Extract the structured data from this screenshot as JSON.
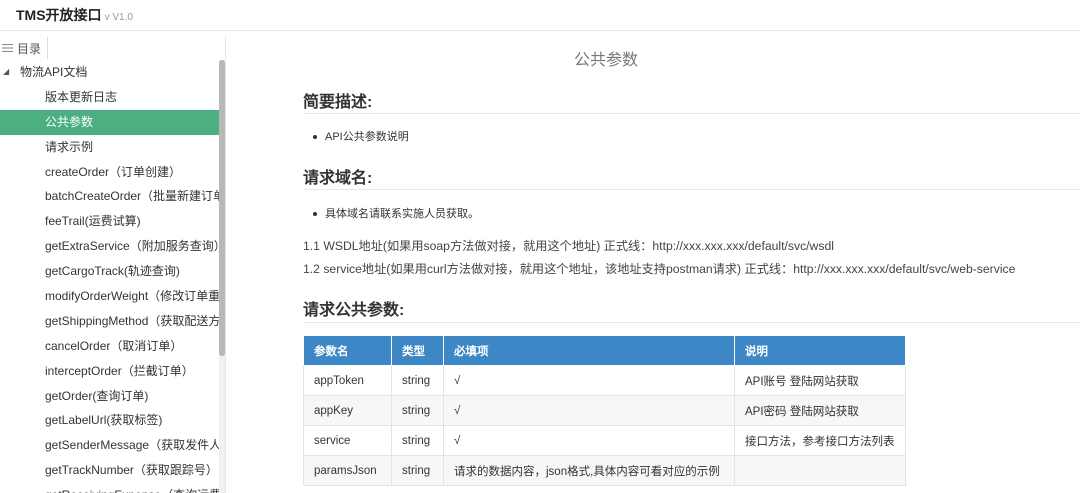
{
  "app": {
    "title": "TMS开放接口",
    "version": "v V1.0"
  },
  "sidebar": {
    "toc_label": "目录",
    "root": "物流API文档",
    "items": [
      {
        "label": "版本更新日志",
        "active": false
      },
      {
        "label": "公共参数",
        "active": true
      },
      {
        "label": "请求示例",
        "active": false
      },
      {
        "label": "createOrder（订单创建）",
        "active": false
      },
      {
        "label": "batchCreateOrder（批量新建订单）",
        "active": false
      },
      {
        "label": "feeTrail(运费试算)",
        "active": false
      },
      {
        "label": "getExtraService（附加服务查询）",
        "active": false
      },
      {
        "label": "getCargoTrack(轨迹查询)",
        "active": false
      },
      {
        "label": "modifyOrderWeight（修改订单重量）",
        "active": false
      },
      {
        "label": "getShippingMethod（获取配送方式）",
        "active": false
      },
      {
        "label": "cancelOrder（取消订单）",
        "active": false
      },
      {
        "label": "interceptOrder（拦截订单）",
        "active": false
      },
      {
        "label": "getOrder(查询订单)",
        "active": false
      },
      {
        "label": "getLabelUrl(获取标签)",
        "active": false
      },
      {
        "label": "getSenderMessage（获取发件人信息）",
        "active": false
      },
      {
        "label": "getTrackNumber（获取跟踪号）",
        "active": false
      },
      {
        "label": "getReceivingExpense（查询运费明细）",
        "active": false
      }
    ]
  },
  "main": {
    "page_title": "公共参数",
    "section1": {
      "heading": "简要描述:",
      "bullet": "API公共参数说明"
    },
    "section2": {
      "heading": "请求域名:",
      "bullet": "具体域名请联系实施人员获取。",
      "line1": "1.1 WSDL地址(如果用soap方法做对接，就用这个地址) 正式线：http://xxx.xxx.xxx/default/svc/wsdl",
      "line2": "1.2 service地址(如果用curl方法做对接，就用这个地址，该地址支持postman请求) 正式线：http://xxx.xxx.xxx/default/svc/web-service"
    },
    "section3": {
      "heading": "请求公共参数:"
    },
    "table": {
      "headers": [
        "参数名",
        "类型",
        "必填项",
        "说明"
      ],
      "rows": [
        [
          "appToken",
          "string",
          "√",
          "API账号 登陆网站获取"
        ],
        [
          "appKey",
          "string",
          "√",
          "API密码 登陆网站获取"
        ],
        [
          "service",
          "string",
          "√",
          "接口方法，参考接口方法列表"
        ],
        [
          "paramsJson",
          "string",
          "请求的数据内容，json格式,具体内容可看对应的示例",
          ""
        ]
      ]
    }
  }
}
